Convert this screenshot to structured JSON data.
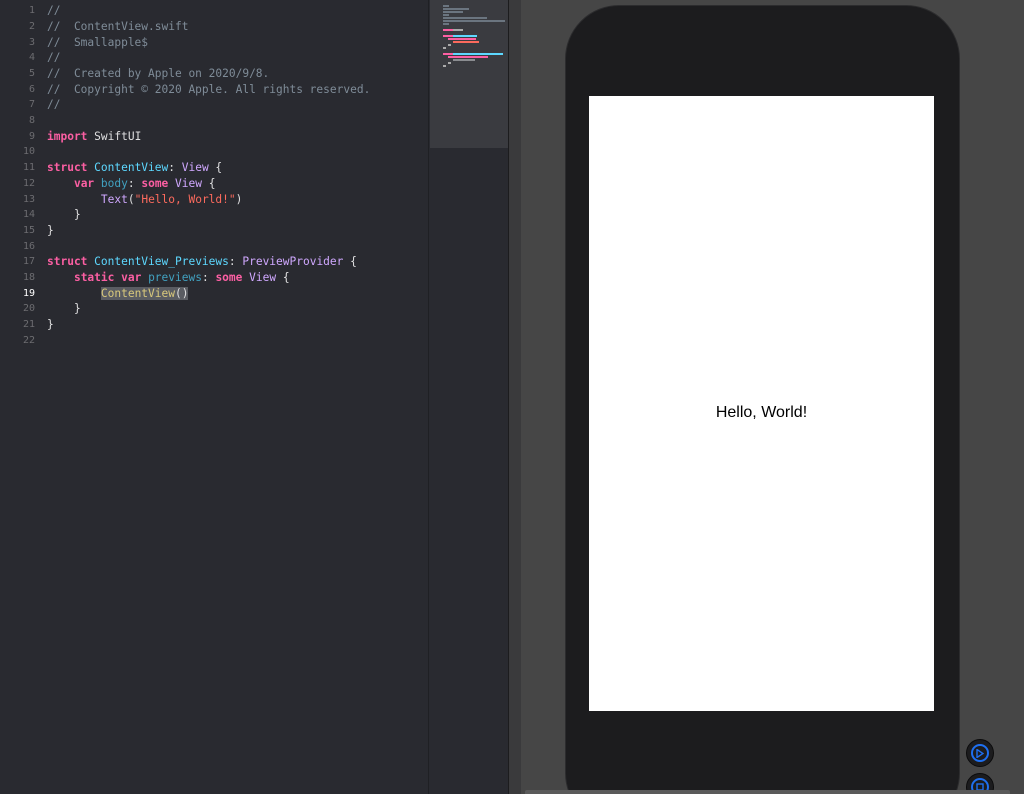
{
  "editor": {
    "current_line": 19,
    "lines": [
      {
        "n": "1"
      },
      {
        "n": "2",
        "t1": "//  ContentView.swift"
      },
      {
        "n": "3",
        "t1": "//  Smallapple$"
      },
      {
        "n": "4",
        "t1": "//"
      },
      {
        "n": "5",
        "t1": "//  Created by Apple on 2020/9/8."
      },
      {
        "n": "6",
        "t1": "//  Copyright © 2020 Apple. All rights reserved."
      },
      {
        "n": "7",
        "t1": "//"
      },
      {
        "n": "8"
      },
      {
        "n": "9",
        "kw": "import",
        "rest": " SwiftUI"
      },
      {
        "n": "10"
      },
      {
        "n": "11",
        "kw": "struct",
        "name": " ContentView",
        "colon": ":",
        "type": " View",
        "brace": " {"
      },
      {
        "n": "12",
        "indent": "    ",
        "kw": "var",
        "name": " body",
        "colon": ":",
        "kw2": " some",
        "type": " View",
        "brace": " {"
      },
      {
        "n": "13",
        "indent": "        ",
        "fn": "Text",
        "open": "(",
        "str": "\"Hello, World!\"",
        "close": ")"
      },
      {
        "n": "14",
        "indent": "    ",
        "brace": "}"
      },
      {
        "n": "15",
        "brace": "}"
      },
      {
        "n": "16"
      },
      {
        "n": "17",
        "kw": "struct",
        "name": " ContentView_Previews",
        "colon": ":",
        "type": " PreviewProvider",
        "brace": " {"
      },
      {
        "n": "18",
        "indent": "    ",
        "kw": "static",
        "kw_b": " var",
        "name": " previews",
        "colon": ":",
        "kw2": " some",
        "type": " View",
        "brace": " {"
      },
      {
        "n": "19",
        "indent": "        ",
        "sel_fn": "ContentView",
        "sel_call": "()"
      },
      {
        "n": "20",
        "indent": "    ",
        "brace": "}"
      },
      {
        "n": "21",
        "brace": "}"
      },
      {
        "n": "22"
      }
    ]
  },
  "line1": "//",
  "preview": {
    "text": "Hello, World!"
  },
  "controls": {
    "live_preview_icon": "play-circle-icon",
    "inspect_icon": "inspect-circle-icon"
  },
  "colors": {
    "editor_bg": "#292a30",
    "keyword": "#fc5fa3",
    "comment": "#7f8c98",
    "string": "#fc6a5d",
    "accent": "#1e6ff0"
  }
}
